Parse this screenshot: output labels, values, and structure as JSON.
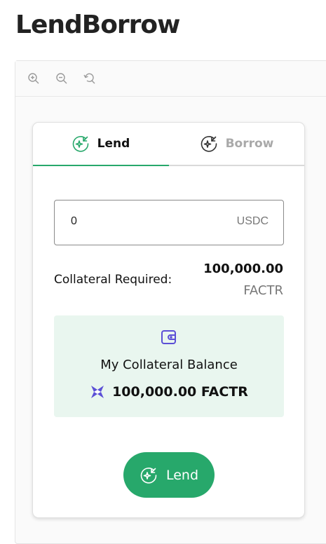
{
  "page": {
    "title": "LendBorrow"
  },
  "toolbar": {
    "tools": [
      "zoom-in-icon",
      "zoom-out-icon",
      "reset-zoom-icon"
    ]
  },
  "tabs": {
    "lend_label": "Lend",
    "borrow_label": "Borrow",
    "active": "Lend"
  },
  "amount": {
    "value": "0",
    "unit": "USDC"
  },
  "collateral": {
    "label": "Collateral Required:",
    "amount": "100,000.00",
    "unit": "FACTR"
  },
  "balance": {
    "title": "My Collateral Balance",
    "amount": "100,000.00 FACTR"
  },
  "action": {
    "label": "Lend"
  },
  "colors": {
    "accent": "#27a86b",
    "panel_bg": "#e9f6ef",
    "icon_purple": "#5b4fd6",
    "muted_text": "#777777",
    "inactive_tab": "#a9a9a9"
  }
}
